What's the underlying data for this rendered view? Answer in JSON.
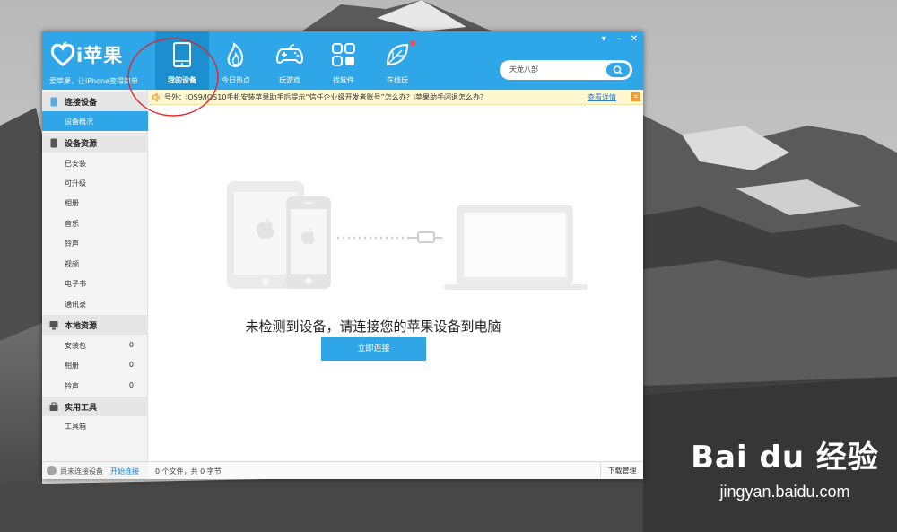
{
  "app": {
    "name": "i苹果",
    "slogan": "爱苹果，让iPhone变得简单",
    "accent_color": "#2ea6e8"
  },
  "window_controls": [
    "▾",
    "–",
    "✕"
  ],
  "nav": [
    {
      "label": "我的设备",
      "icon": "tablet-icon",
      "active": true
    },
    {
      "label": "今日热点",
      "icon": "flame-icon",
      "active": false
    },
    {
      "label": "玩游戏",
      "icon": "gamepad-icon",
      "active": false
    },
    {
      "label": "找软件",
      "icon": "apps-grid-icon",
      "active": false
    },
    {
      "label": "在线玩",
      "icon": "leaf-icon",
      "active": false,
      "badge": true
    }
  ],
  "search": {
    "value": "天龙八部",
    "button_icon": "search-icon"
  },
  "notice": {
    "text": "号外：IOS9/IOS10手机安装苹果助手后提示“信任企业级开发者账号”怎么办？i苹果助手闪退怎么办？",
    "link": "查看详情",
    "close": "×"
  },
  "sidebar": {
    "sections": [
      {
        "title": "连接设备",
        "icon": "phone-icon",
        "items": [
          {
            "label": "设备概况",
            "count": "",
            "active": true
          }
        ]
      },
      {
        "title": "设备资源",
        "icon": "phone-icon",
        "items": [
          {
            "label": "已安装",
            "count": ""
          },
          {
            "label": "可升级",
            "count": ""
          },
          {
            "label": "相册",
            "count": ""
          },
          {
            "label": "音乐",
            "count": ""
          },
          {
            "label": "铃声",
            "count": ""
          },
          {
            "label": "视频",
            "count": ""
          },
          {
            "label": "电子书",
            "count": ""
          },
          {
            "label": "通讯录",
            "count": ""
          }
        ]
      },
      {
        "title": "本地资源",
        "icon": "monitor-icon",
        "items": [
          {
            "label": "安装包",
            "count": "0"
          },
          {
            "label": "相册",
            "count": "0"
          },
          {
            "label": "铃声",
            "count": "0"
          }
        ]
      },
      {
        "title": "实用工具",
        "icon": "toolbox-icon",
        "items": [
          {
            "label": "工具箱",
            "count": ""
          }
        ]
      }
    ],
    "footer": {
      "status": "尚未连接设备",
      "link": "开始连接"
    }
  },
  "main": {
    "empty_message": "未检测到设备，请连接您的苹果设备到电脑",
    "connect_button": "立即连接"
  },
  "statusbar": {
    "summary": "0 个文件，共 0 字节",
    "downloads": "下载管理"
  },
  "watermark": {
    "logo": "Bai du 经验",
    "url": "jingyan.baidu.com"
  }
}
